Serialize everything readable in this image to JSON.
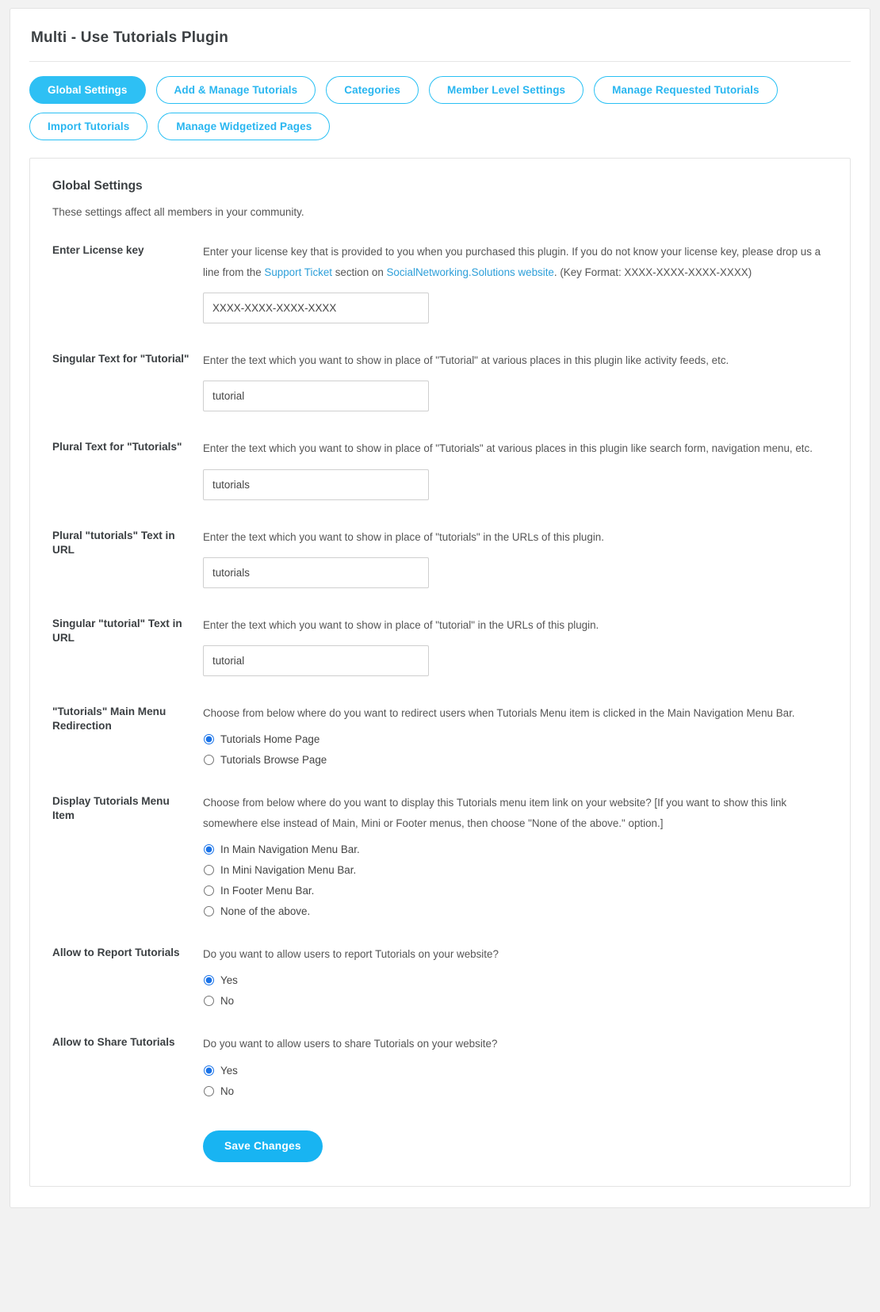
{
  "header": {
    "title": "Multi - Use Tutorials Plugin"
  },
  "tabs": [
    {
      "label": "Global Settings",
      "active": true
    },
    {
      "label": "Add & Manage Tutorials",
      "active": false
    },
    {
      "label": "Categories",
      "active": false
    },
    {
      "label": "Member Level Settings",
      "active": false
    },
    {
      "label": "Manage Requested Tutorials",
      "active": false
    },
    {
      "label": "Import Tutorials",
      "active": false
    },
    {
      "label": "Manage Widgetized Pages",
      "active": false
    }
  ],
  "panel": {
    "heading": "Global Settings",
    "subtitle": "These settings affect all members in your community."
  },
  "fields": {
    "license": {
      "label": "Enter License key",
      "desc_part1": "Enter your license key that is provided to you when you purchased this plugin. If you do not know your license key, please drop us a line from the ",
      "link1": "Support Ticket",
      "desc_part2": " section on ",
      "link2": "SocialNetworking.Solutions website",
      "desc_part3": ". (Key Format: XXXX-XXXX-XXXX-XXXX)",
      "value": "XXXX-XXXX-XXXX-XXXX",
      "placeholder": "XXXX-XXXX-XXXX-XXXX"
    },
    "singular_text": {
      "label": "Singular Text for \"Tutorial\"",
      "desc": "Enter the text which you want to show in place of \"Tutorial\" at various places in this plugin like activity feeds, etc.",
      "value": "tutorial",
      "placeholder": "tutorial"
    },
    "plural_text": {
      "label": "Plural Text for \"Tutorials\"",
      "desc": "Enter the text which you want to show in place of \"Tutorials\" at various places in this plugin like search form, navigation menu, etc.",
      "value": "tutorials",
      "placeholder": "tutorials"
    },
    "plural_url": {
      "label": "Plural \"tutorials\" Text in URL",
      "desc": "Enter the text which you want to show in place of \"tutorials\" in the URLs of this plugin.",
      "value": "tutorials",
      "placeholder": "tutorials"
    },
    "singular_url": {
      "label": "Singular \"tutorial\" Text in URL",
      "desc": "Enter the text which you want to show in place of \"tutorial\" in the URLs of this plugin.",
      "value": "tutorial",
      "placeholder": "tutorial"
    },
    "menu_redirection": {
      "label": "\"Tutorials\" Main Menu Redirection",
      "desc": "Choose from below where do you want to redirect users when Tutorials Menu item is clicked in the Main Navigation Menu Bar.",
      "options": [
        {
          "label": "Tutorials Home Page",
          "checked": true
        },
        {
          "label": "Tutorials Browse Page",
          "checked": false
        }
      ]
    },
    "display_menu_item": {
      "label": "Display Tutorials Menu Item",
      "desc": "Choose from below where do you want to display this Tutorials menu item link on your website? [If you want to show this link somewhere else instead of Main, Mini or Footer menus, then choose \"None of the above.\" option.]",
      "options": [
        {
          "label": "In Main Navigation Menu Bar.",
          "checked": true
        },
        {
          "label": "In Mini Navigation Menu Bar.",
          "checked": false
        },
        {
          "label": "In Footer Menu Bar.",
          "checked": false
        },
        {
          "label": "None of the above.",
          "checked": false
        }
      ]
    },
    "allow_report": {
      "label": "Allow to Report Tutorials",
      "desc": "Do you want to allow users to report Tutorials on your website?",
      "options": [
        {
          "label": "Yes",
          "checked": true
        },
        {
          "label": "No",
          "checked": false
        }
      ]
    },
    "allow_share": {
      "label": "Allow to Share Tutorials",
      "desc": "Do you want to allow users to share Tutorials on your website?",
      "options": [
        {
          "label": "Yes",
          "checked": true
        },
        {
          "label": "No",
          "checked": false
        }
      ]
    }
  },
  "actions": {
    "save_label": "Save Changes"
  },
  "colors": {
    "accent": "#2ec0f4",
    "save_button": "#18b4f2",
    "link": "#2d9fd9",
    "radio": "#1a73e8"
  }
}
